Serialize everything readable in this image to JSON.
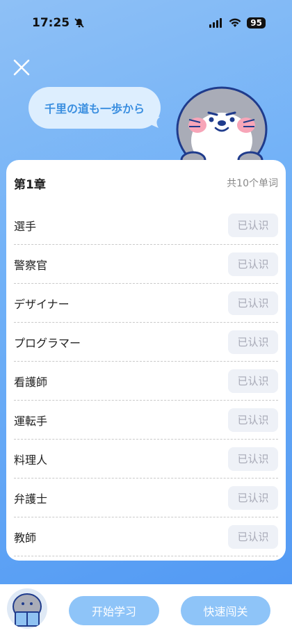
{
  "status_bar": {
    "time": "17:25",
    "battery": "95"
  },
  "bubble": {
    "text": "千里の道も一歩から"
  },
  "card": {
    "chapter": "第1章",
    "count": "共10个单词",
    "known_label": "已认识",
    "words": [
      {
        "word": "選手"
      },
      {
        "word": "警察官"
      },
      {
        "word": "デザイナー"
      },
      {
        "word": "プログラマー"
      },
      {
        "word": "看護師"
      },
      {
        "word": "運転手"
      },
      {
        "word": "料理人"
      },
      {
        "word": "弁護士"
      },
      {
        "word": "教師"
      }
    ]
  },
  "bottom_bar": {
    "start_label": "开始学习",
    "quick_label": "快速闯关"
  },
  "colors": {
    "accent": "#3b8fe0",
    "button": "#8ec4f8",
    "known_bg": "#eef1f7"
  }
}
